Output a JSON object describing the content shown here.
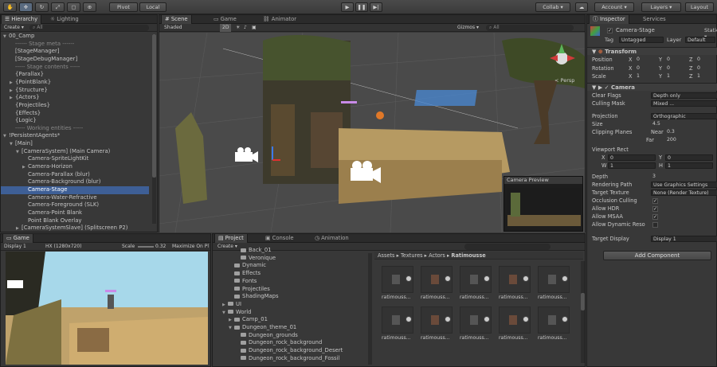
{
  "toolbar": {
    "pivot": "Pivot",
    "local": "Local",
    "collab": "Collab ▾",
    "account": "Account ▾",
    "layers": "Layers ▾",
    "layout": "Layout"
  },
  "hierarchy": {
    "tabs": [
      "Hierarchy",
      "Lighting"
    ],
    "create": "Create ▾",
    "search": "All",
    "items": [
      {
        "text": "00_Camp",
        "tri": "▼",
        "indent": 0
      },
      {
        "text": "------ Stage meta ------",
        "indent": 1,
        "sep": true
      },
      {
        "text": "[StageManager]",
        "indent": 1
      },
      {
        "text": "[StageDebugManager]",
        "indent": 1
      },
      {
        "text": "----- Stage contents -----",
        "indent": 1,
        "sep": true
      },
      {
        "text": "{Parallax}",
        "indent": 1
      },
      {
        "text": "{PointBlank}",
        "tri": "▶",
        "indent": 1
      },
      {
        "text": "{Structure}",
        "tri": "▶",
        "indent": 1
      },
      {
        "text": "{Actors}",
        "tri": "▶",
        "indent": 1
      },
      {
        "text": "{Projectiles}",
        "indent": 1
      },
      {
        "text": "{Effects}",
        "indent": 1
      },
      {
        "text": "{Logic}",
        "indent": 1
      },
      {
        "text": "----- Working entities -----",
        "indent": 1,
        "sep": true
      },
      {
        "text": "!PersistentAgents*",
        "tri": "▼",
        "indent": 0
      },
      {
        "text": "[Main]",
        "tri": "▼",
        "indent": 1
      },
      {
        "text": "[CameraSystem] (Main Camera)",
        "tri": "▼",
        "indent": 2
      },
      {
        "text": "Camera-SpriteLightKit",
        "indent": 3
      },
      {
        "text": "Camera-Horizon",
        "tri": "▶",
        "indent": 3
      },
      {
        "text": "Camera-Parallax (blur)",
        "indent": 3
      },
      {
        "text": "Camera-Background (blur)",
        "indent": 3
      },
      {
        "text": "Camera-Stage",
        "indent": 3,
        "selected": true
      },
      {
        "text": "Camera-Water-Refractive",
        "indent": 3
      },
      {
        "text": "Camera-Foreground (SLK)",
        "indent": 3
      },
      {
        "text": "Camera-Point Blank",
        "indent": 3
      },
      {
        "text": "Point Blank Overlay",
        "indent": 3
      },
      {
        "text": "[CameraSystemSlave] (Splitscreen P2)",
        "tri": "▶",
        "indent": 2
      }
    ]
  },
  "scene": {
    "tabs": [
      "Scene",
      "Game",
      "Animator"
    ],
    "shading": "Shaded",
    "mode2d": "2D",
    "gizmos": "Gizmos ▾",
    "search": "All",
    "persp": "< Persp",
    "preview_title": "Camera Preview"
  },
  "game": {
    "tab": "Game",
    "display": "Display 1",
    "resolution": "HX (1280x720)",
    "scale_label": "Scale",
    "scale": "0.32",
    "maximize": "Maximize On Pl"
  },
  "project": {
    "tabs": [
      "Project",
      "Console",
      "Animation"
    ],
    "create": "Create ▾",
    "folders": [
      {
        "text": "Back_01",
        "indent": 3
      },
      {
        "text": "Veronique",
        "indent": 3
      },
      {
        "text": "Dynamic",
        "indent": 2
      },
      {
        "text": "Effects",
        "indent": 2
      },
      {
        "text": "Fonts",
        "indent": 2
      },
      {
        "text": "Projectiles",
        "indent": 2
      },
      {
        "text": "ShadingMaps",
        "indent": 2
      },
      {
        "text": "UI",
        "tri": "▶",
        "indent": 1
      },
      {
        "text": "World",
        "tri": "▼",
        "indent": 1
      },
      {
        "text": "Camp_01",
        "tri": "▶",
        "indent": 2
      },
      {
        "text": "Dungeon_theme_01",
        "tri": "▼",
        "indent": 2
      },
      {
        "text": "Dungeon_grounds",
        "indent": 3
      },
      {
        "text": "Dungeon_rock_background",
        "indent": 3
      },
      {
        "text": "Dungeon_rock_background_Desert",
        "indent": 3
      },
      {
        "text": "Dungeon_rock_background_Fossil",
        "indent": 3
      }
    ],
    "breadcrumb": [
      "Assets",
      "Textures",
      "Actors",
      "Ratimousse"
    ],
    "asset_label": "ratimouss..."
  },
  "inspector": {
    "tabs": [
      "Inspector",
      "Services"
    ],
    "name": "Camera-Stage",
    "static": "Static ▾",
    "tag_label": "Tag",
    "tag": "Untagged",
    "layer_label": "Layer",
    "layer": "Default",
    "transform": {
      "title": "Transform",
      "rows": [
        {
          "label": "Position",
          "x": "0",
          "y": "0",
          "z": "0"
        },
        {
          "label": "Rotation",
          "x": "0",
          "y": "0",
          "z": "0"
        },
        {
          "label": "Scale",
          "x": "1",
          "y": "1",
          "z": "1"
        }
      ]
    },
    "camera": {
      "title": "Camera",
      "clear_flags_label": "Clear Flags",
      "clear_flags": "Depth only",
      "culling_label": "Culling Mask",
      "culling": "Mixed ...",
      "projection_label": "Projection",
      "projection": "Orthographic",
      "size_label": "Size",
      "size": "4.5",
      "clip_label": "Clipping Planes",
      "near_label": "Near",
      "near": "0.3",
      "far_label": "Far",
      "far": "200",
      "viewport_label": "Viewport Rect",
      "vx": "0",
      "vy": "0",
      "vw": "1",
      "vh": "1",
      "depth_label": "Depth",
      "depth": "3",
      "render_path_label": "Rendering Path",
      "render_path": "Use Graphics Settings",
      "target_tex_label": "Target Texture",
      "target_tex": "None (Render Texture)",
      "occlusion_label": "Occlusion Culling",
      "hdr_label": "Allow HDR",
      "msaa_label": "Allow MSAA",
      "dynres_label": "Allow Dynamic Reso",
      "target_display_label": "Target Display",
      "target_display": "Display 1"
    },
    "add_component": "Add Component"
  },
  "colors": {
    "selection": "#3e5f96",
    "panel": "#383838",
    "scene_bg": "#454545"
  }
}
